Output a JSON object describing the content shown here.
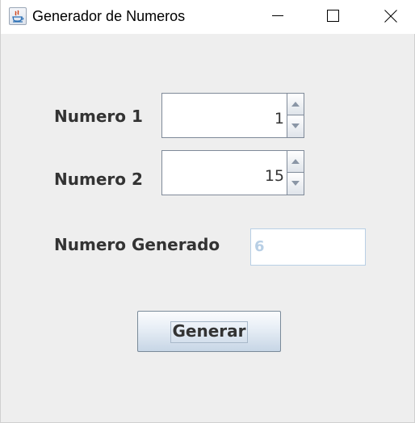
{
  "window": {
    "title": "Generador de Numeros",
    "icon": "java-icon"
  },
  "controls": {
    "minimize_icon": "minimize-icon",
    "maximize_icon": "maximize-icon",
    "close_icon": "close-icon"
  },
  "form": {
    "numero1_label": "Numero 1",
    "numero1_value": "1",
    "numero2_label": "Numero 2",
    "numero2_value": "15",
    "generado_label": "Numero Generado",
    "generado_value": "6"
  },
  "actions": {
    "generar_label": "Generar"
  },
  "colors": {
    "window_bg": "#eeeeee",
    "label_text": "#333333",
    "disabled_text": "#b8cfe5",
    "button_border": "#7a8a99"
  }
}
